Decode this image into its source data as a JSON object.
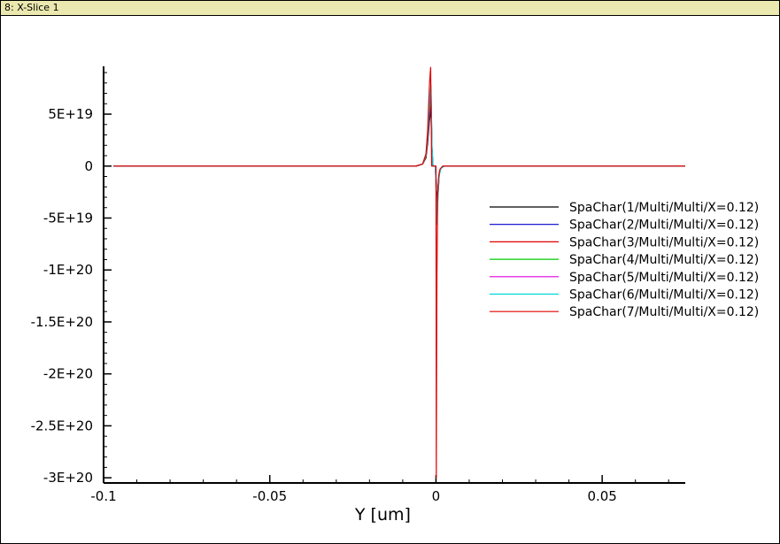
{
  "window": {
    "title": "8: X-Slice 1"
  },
  "chart_data": {
    "type": "line",
    "title": "",
    "xlabel": "Y [um]",
    "ylabel": "",
    "xlim": [
      -0.1,
      0.075
    ],
    "ylim": [
      -3.05e+20,
      9.6e+19
    ],
    "x_ticks": [
      {
        "value": -0.1,
        "label": "-0.1"
      },
      {
        "value": -0.05,
        "label": "-0.05"
      },
      {
        "value": 0,
        "label": "0"
      },
      {
        "value": 0.05,
        "label": "0.05"
      }
    ],
    "y_ticks": [
      {
        "value": 5e+19,
        "label": "5E+19"
      },
      {
        "value": 0,
        "label": "0"
      },
      {
        "value": -5e+19,
        "label": "-5E+19"
      },
      {
        "value": -1e+20,
        "label": "-1E+20"
      },
      {
        "value": -1.5e+20,
        "label": "-1.5E+20"
      },
      {
        "value": -2e+20,
        "label": "-2E+20"
      },
      {
        "value": -2.5e+20,
        "label": "-2.5E+20"
      },
      {
        "value": -3e+20,
        "label": "-3E+20"
      }
    ],
    "legend_position": "right",
    "series": [
      {
        "name": "SpaChar(1/Multi/Multi/X=0.12)",
        "color": "#000000",
        "x": [
          -0.097,
          -0.01,
          -0.006,
          -0.004,
          -0.003,
          -0.0025,
          -0.002,
          -0.0015,
          -0.0012,
          -0.0009,
          -0.0006,
          -0.0002,
          0.0,
          0.0003,
          0.0006,
          0.001,
          0.0015,
          0.0025,
          0.004,
          0.075
        ],
        "y": [
          0,
          0,
          0,
          2e+18,
          8e+18,
          2.2e+19,
          4.2e+19,
          5.5e+19,
          1.5e+19,
          0,
          0,
          0,
          -1e+19,
          -3.8e+19,
          -2e+19,
          -6e+18,
          -2e+18,
          0,
          0,
          0
        ]
      },
      {
        "name": "SpaChar(2/Multi/Multi/X=0.12)",
        "color": "#0000cc",
        "x": [
          -0.097,
          -0.01,
          -0.006,
          -0.004,
          -0.003,
          -0.0025,
          -0.002,
          -0.0015,
          -0.0012,
          -0.0009,
          -0.0006,
          -0.0002,
          0.0,
          0.0003,
          0.0006,
          0.001,
          0.0015,
          0.0025,
          0.004,
          0.075
        ],
        "y": [
          0,
          0,
          0,
          2e+18,
          9e+18,
          2.5e+19,
          4.6e+19,
          6e+19,
          1.6e+19,
          0,
          0,
          0,
          -1.2e+19,
          -4.2e+19,
          -2.2e+19,
          -7e+18,
          -2e+18,
          0,
          0,
          0
        ]
      },
      {
        "name": "SpaChar(3/Multi/Multi/X=0.12)",
        "color": "#e00000",
        "x": [
          -0.097,
          -0.01,
          -0.006,
          -0.004,
          -0.003,
          -0.0025,
          -0.002,
          -0.0015,
          -0.0012,
          -0.0009,
          -0.0006,
          -0.0002,
          0.0,
          0.0003,
          0.0006,
          0.001,
          0.0015,
          0.0025,
          0.004,
          0.075
        ],
        "y": [
          0,
          0,
          0,
          2e+18,
          9e+18,
          2.6e+19,
          5e+19,
          6.4e+19,
          1.7e+19,
          0,
          0,
          0,
          -1.4e+19,
          -4.6e+19,
          -2.4e+19,
          -7e+18,
          -2e+18,
          0,
          0,
          0
        ]
      },
      {
        "name": "SpaChar(4/Multi/Multi/X=0.12)",
        "color": "#00cc00",
        "x": [
          -0.097,
          -0.01,
          -0.006,
          -0.004,
          -0.003,
          -0.0025,
          -0.002,
          -0.0015,
          -0.0012,
          -0.0009,
          -0.0006,
          -0.0002,
          0.0,
          0.0003,
          0.0006,
          0.001,
          0.0015,
          0.0025,
          0.004,
          0.075
        ],
        "y": [
          0,
          0,
          0,
          2e+18,
          1e+19,
          2.8e+19,
          5.4e+19,
          6.8e+19,
          1.8e+19,
          0,
          0,
          0,
          -1.6e+19,
          -5e+19,
          -2.6e+19,
          -8e+18,
          -2e+18,
          0,
          0,
          0
        ]
      },
      {
        "name": "SpaChar(5/Multi/Multi/X=0.12)",
        "color": "#e000e0",
        "x": [
          -0.097,
          -0.01,
          -0.006,
          -0.004,
          -0.003,
          -0.0025,
          -0.002,
          -0.0015,
          -0.0012,
          -0.0009,
          -0.0006,
          -0.0002,
          0.0,
          0.0003,
          0.0006,
          0.001,
          0.0015,
          0.0025,
          0.004,
          0.075
        ],
        "y": [
          0,
          0,
          0,
          2e+18,
          1.1e+19,
          3e+19,
          5.8e+19,
          7.3e+19,
          1.9e+19,
          0,
          0,
          0,
          -1.8e+19,
          -5.4e+19,
          -2.8e+19,
          -8e+18,
          -2e+18,
          0,
          0,
          0
        ]
      },
      {
        "name": "SpaChar(6/Multi/Multi/X=0.12)",
        "color": "#00d8d8",
        "x": [
          -0.097,
          -0.01,
          -0.006,
          -0.004,
          -0.003,
          -0.0025,
          -0.002,
          -0.0015,
          -0.0012,
          -0.0009,
          -0.0006,
          -0.0002,
          0.0,
          0.0003,
          0.0006,
          0.001,
          0.0015,
          0.0025,
          0.004,
          0.075
        ],
        "y": [
          0,
          0,
          0,
          2e+18,
          1.1e+19,
          3.2e+19,
          6.2e+19,
          7.8e+19,
          2e+19,
          0,
          0,
          0,
          -2e+19,
          -5.6e+19,
          -3e+19,
          -9e+18,
          -2e+18,
          0,
          0,
          0
        ]
      },
      {
        "name": "SpaChar(7/Multi/Multi/X=0.12)",
        "color": "#e00000",
        "x": [
          -0.097,
          -0.01,
          -0.006,
          -0.004,
          -0.003,
          -0.0025,
          -0.0022,
          -0.0019,
          -0.0016,
          -0.0013,
          -0.001,
          -0.0005,
          -0.0002,
          0.0,
          0.0001,
          0.0002,
          0.0003,
          0.0005,
          0.0008,
          0.0012,
          0.002,
          0.004,
          0.075
        ],
        "y": [
          0,
          0,
          0,
          2e+18,
          1.2e+19,
          3.5e+19,
          6e+19,
          8.2e+19,
          9.5e+19,
          0,
          0,
          0,
          0,
          0,
          -3e+20,
          -1.8e+20,
          -1.05e+20,
          -3e+19,
          -1e+19,
          -3e+18,
          0,
          0,
          0
        ]
      }
    ]
  }
}
